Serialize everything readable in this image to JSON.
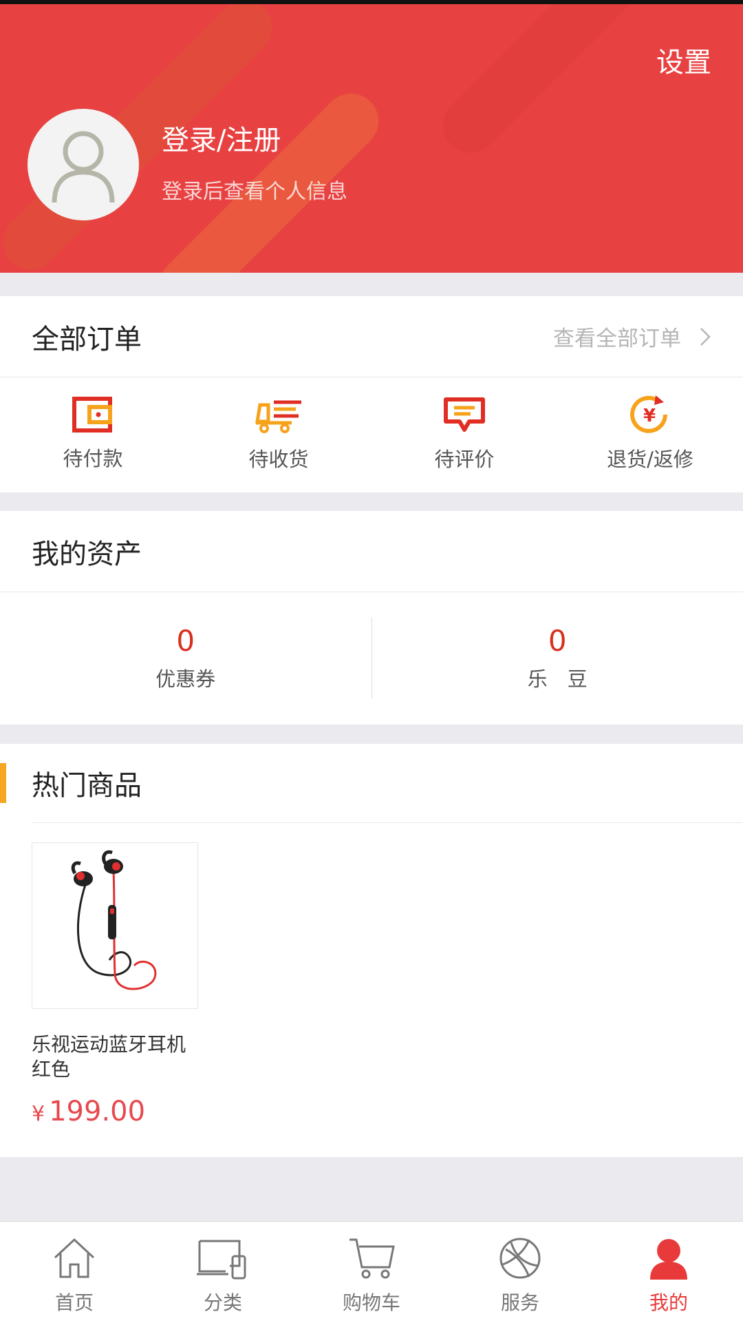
{
  "header": {
    "settings_label": "设置",
    "login_title": "登录/注册",
    "login_subtitle": "登录后查看个人信息"
  },
  "orders": {
    "title": "全部订单",
    "view_all_label": "查看全部订单",
    "items": [
      {
        "label": "待付款",
        "icon": "wallet-icon"
      },
      {
        "label": "待收货",
        "icon": "delivery-truck-icon"
      },
      {
        "label": "待评价",
        "icon": "comment-icon"
      },
      {
        "label": "退货/返修",
        "icon": "refund-icon"
      }
    ]
  },
  "assets": {
    "title": "我的资产",
    "items": [
      {
        "value": "0",
        "label": "优惠券"
      },
      {
        "value": "0",
        "label": "乐　豆"
      }
    ]
  },
  "hot": {
    "title": "热门商品",
    "products": [
      {
        "name": "乐视运动蓝牙耳机 红色",
        "currency": "¥",
        "price": "199.00",
        "image": "bluetooth-earphones-image"
      }
    ]
  },
  "tabbar": {
    "items": [
      {
        "label": "首页",
        "icon": "home-icon"
      },
      {
        "label": "分类",
        "icon": "category-icon"
      },
      {
        "label": "购物车",
        "icon": "cart-icon"
      },
      {
        "label": "服务",
        "icon": "service-globe-icon"
      },
      {
        "label": "我的",
        "icon": "user-icon"
      }
    ],
    "active_index": 4
  },
  "colors": {
    "brand_red": "#e84141",
    "accent_orange": "#f5a623",
    "price_red": "#e8484d"
  }
}
